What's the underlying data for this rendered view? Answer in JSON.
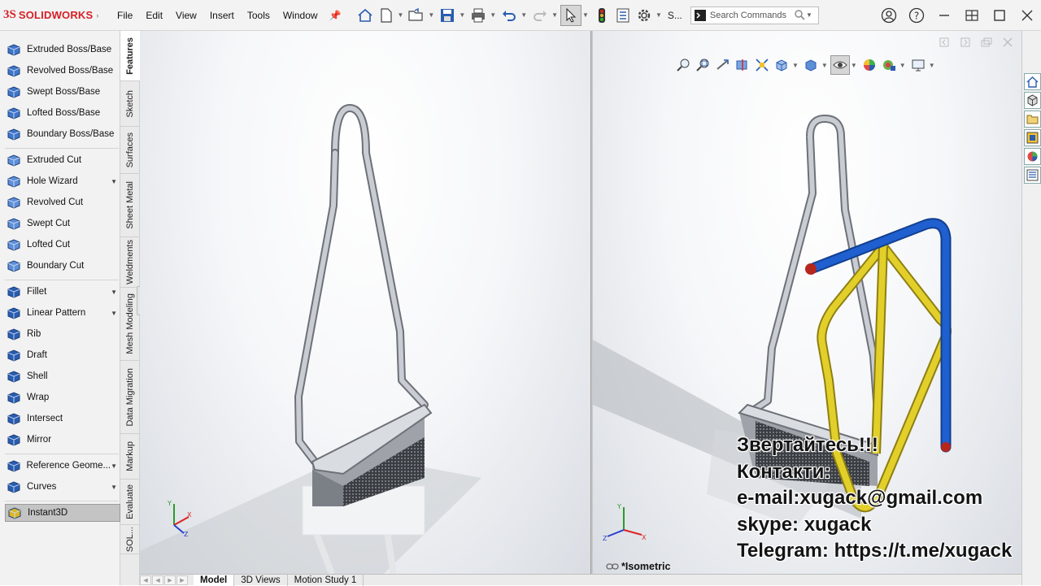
{
  "app": {
    "logo_prefix": "3S",
    "logo_text": "SOLIDWORKS"
  },
  "menu": [
    "File",
    "Edit",
    "View",
    "Insert",
    "Tools",
    "Window"
  ],
  "toolbar": {
    "truncated_label": "S...",
    "search_placeholder": "Search Commands"
  },
  "features": {
    "groups": [
      [
        {
          "label": "Extruded Boss/Base",
          "icon": "extruded-boss-icon"
        },
        {
          "label": "Revolved Boss/Base",
          "icon": "revolved-boss-icon"
        },
        {
          "label": "Swept Boss/Base",
          "icon": "swept-boss-icon"
        },
        {
          "label": "Lofted Boss/Base",
          "icon": "lofted-boss-icon"
        },
        {
          "label": "Boundary Boss/Base",
          "icon": "boundary-boss-icon"
        }
      ],
      [
        {
          "label": "Extruded Cut",
          "icon": "extruded-cut-icon"
        },
        {
          "label": "Hole Wizard",
          "icon": "hole-wizard-icon",
          "dropdown": true
        },
        {
          "label": "Revolved Cut",
          "icon": "revolved-cut-icon"
        },
        {
          "label": "Swept Cut",
          "icon": "swept-cut-icon"
        },
        {
          "label": "Lofted Cut",
          "icon": "lofted-cut-icon"
        },
        {
          "label": "Boundary Cut",
          "icon": "boundary-cut-icon"
        }
      ],
      [
        {
          "label": "Fillet",
          "icon": "fillet-icon",
          "dropdown": true
        },
        {
          "label": "Linear Pattern",
          "icon": "linear-pattern-icon",
          "dropdown": true
        },
        {
          "label": "Rib",
          "icon": "rib-icon"
        },
        {
          "label": "Draft",
          "icon": "draft-icon"
        },
        {
          "label": "Shell",
          "icon": "shell-icon"
        },
        {
          "label": "Wrap",
          "icon": "wrap-icon"
        },
        {
          "label": "Intersect",
          "icon": "intersect-icon"
        },
        {
          "label": "Mirror",
          "icon": "mirror-icon"
        }
      ],
      [
        {
          "label": "Reference Geome...",
          "icon": "reference-geometry-icon",
          "dropdown": true
        },
        {
          "label": "Curves",
          "icon": "curves-icon",
          "dropdown": true
        }
      ],
      [
        {
          "label": "Instant3D",
          "icon": "instant3d-icon",
          "active": true
        }
      ]
    ]
  },
  "side_tabs": [
    "Features",
    "Sketch",
    "Surfaces",
    "Sheet Metal",
    "Weldments",
    "Mesh Modeling",
    "Data Migration",
    "Markup",
    "Evaluate",
    "SOL..."
  ],
  "viewport2": {
    "view_label": "*Isometric"
  },
  "overlay": {
    "lines": [
      "Звертайтесь!!!",
      "Контакти:",
      "e-mail:xugack@gmail.com",
      "skype: xugack",
      "Telegram: https://t.me/xugack"
    ]
  },
  "bottom_tabs": [
    "Model",
    "3D Views",
    "Motion Study 1"
  ],
  "colors": {
    "brand_red": "#d71f26",
    "pipe_blue": "#1f5fcf",
    "pipe_yellow": "#e2cf2a",
    "metal": "#9fa4ab"
  }
}
